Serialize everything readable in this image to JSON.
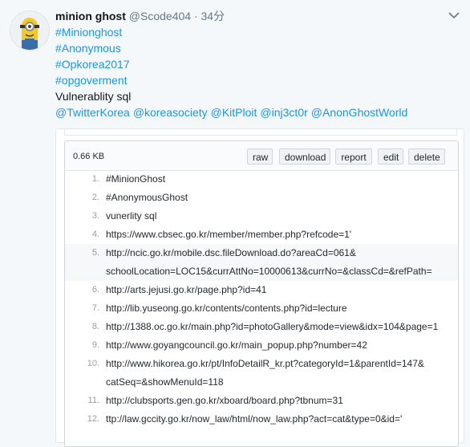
{
  "author": {
    "name": "minion ghost",
    "handle": "@Scode404",
    "time": "· 34分"
  },
  "tweet": {
    "hashtags": [
      "#Minionghost",
      "#Anonymous",
      "#Opkorea2017",
      "#opgoverment"
    ],
    "text": "Vulnerablity sql",
    "mentions": [
      "@TwitterKorea",
      "@koreasociety",
      "@KitPloit",
      "@inj3ct0r",
      "@AnonGhostWorld"
    ]
  },
  "gist": {
    "size": "0.66 KB",
    "buttons": [
      "raw",
      "download",
      "report",
      "edit",
      "delete"
    ],
    "lines": [
      {
        "n": "1.",
        "t": "#MinionGhost"
      },
      {
        "n": "2.",
        "t": "#AnonymousGhost"
      },
      {
        "n": "3.",
        "t": "vunerlity sql"
      },
      {
        "n": "4.",
        "t": "https://www.cbsec.go.kr/member/member.php?refcode=1'"
      },
      {
        "n": "5.",
        "t": "http://ncic.go.kr/mobile.dsc.fileDownload.do?areaCd=061&",
        "t2": "schoolLocation=LOC15&currAttNo=10000613&currNo=&classCd=&refPath="
      },
      {
        "n": "6.",
        "t": "http://arts.jejusi.go.kr/page.php?id=41"
      },
      {
        "n": "7.",
        "t": "http://lib.yuseong.go.kr/contents/contents.php?id=lecture"
      },
      {
        "n": "8.",
        "t": "http://1388.oc.go.kr/main.php?id=photoGallery&mode=view&idx=104&page=1"
      },
      {
        "n": "9.",
        "t": "http://www.goyangcouncil.go.kr/main_popup.php?number=42"
      },
      {
        "n": "10.",
        "t": "http://www.hikorea.go.kr/pt/InfoDetailR_kr.pt?categoryId=1&parentId=147&",
        "t2": "catSeq=&showMenuId=118"
      },
      {
        "n": "11.",
        "t": "http://clubsports.gen.go.kr/xboard/board.php?tbnum=31"
      },
      {
        "n": "12.",
        "t": "ttp://law.gccity.go.kr/now_law/html/now_law.php?act=cat&type=0&id='"
      }
    ]
  }
}
